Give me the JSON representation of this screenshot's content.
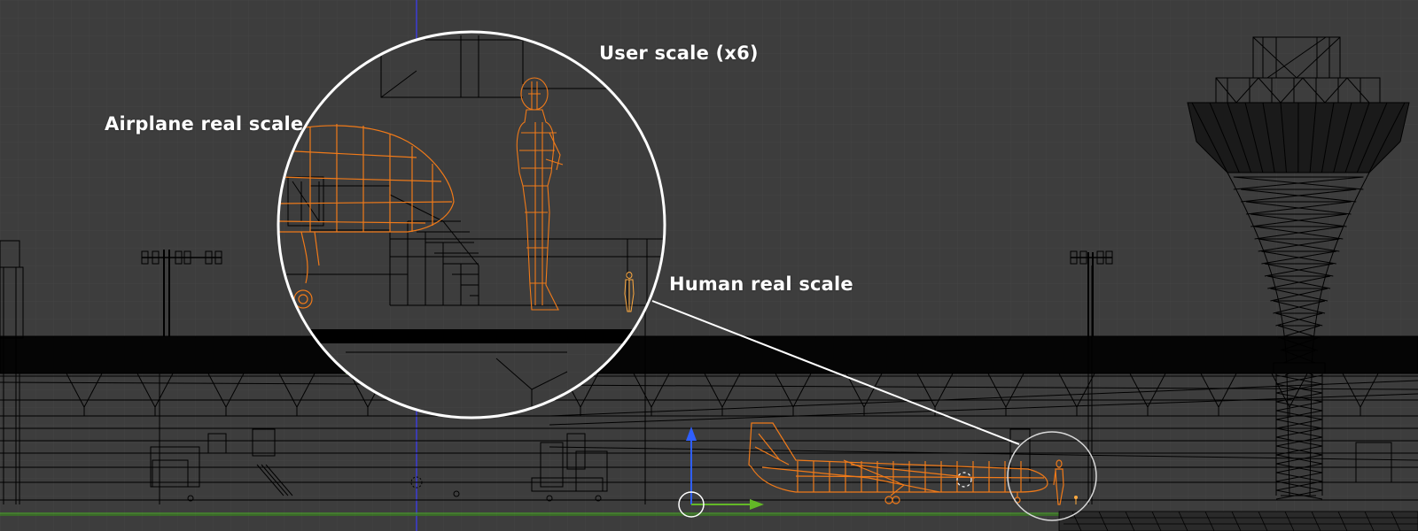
{
  "annotations": {
    "user_scale": "User scale (x6)",
    "airplane_real_scale": "Airplane real scale",
    "human_real_scale": "Human real scale"
  },
  "colors": {
    "background": "#3d3d3d",
    "grid": "#464646",
    "wireframe": "#000000",
    "selected": "#f07a19",
    "active": "#ffaa40",
    "axis_x": "#63b827",
    "axis_y": "#2f5fff",
    "axis_z": "#3d3dd6",
    "lens": "#ffffff"
  },
  "icons": {
    "transform_gizmo": "move-gizmo-icon",
    "cursor": "3d-cursor-icon"
  }
}
